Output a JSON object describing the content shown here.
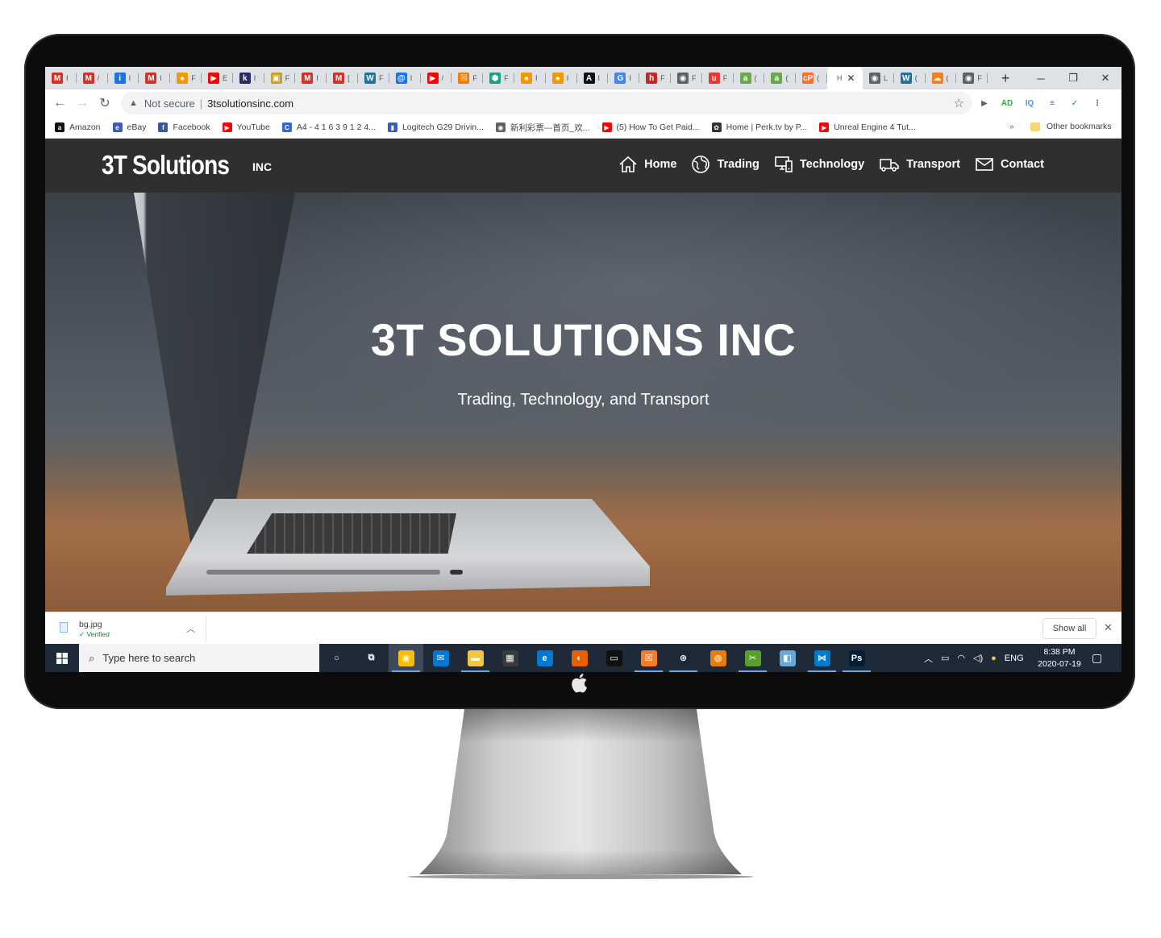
{
  "browser": {
    "tabs": [
      {
        "icon": "gmail-icon",
        "letter": "M",
        "color": "#d93025",
        "title": "I"
      },
      {
        "icon": "gmail-icon",
        "letter": "M",
        "color": "#d93025",
        "title": "/"
      },
      {
        "icon": "info-icon",
        "letter": "i",
        "color": "#1a73e8",
        "title": "I"
      },
      {
        "icon": "gmail-icon",
        "letter": "M",
        "color": "#d93025",
        "title": "I"
      },
      {
        "icon": "orange-leaf-icon",
        "letter": "♠",
        "color": "#f29900",
        "title": "F"
      },
      {
        "icon": "youtube-icon",
        "letter": "▶",
        "color": "#ff0000",
        "title": "E"
      },
      {
        "icon": "k-icon",
        "letter": "k",
        "color": "#2a2a6a",
        "title": "I"
      },
      {
        "icon": "gold-icon",
        "letter": "▣",
        "color": "#c9a227",
        "title": "F"
      },
      {
        "icon": "gmail-icon",
        "letter": "M",
        "color": "#d93025",
        "title": "I"
      },
      {
        "icon": "gmail-icon",
        "letter": "M",
        "color": "#d93025",
        "title": "["
      },
      {
        "icon": "wordpress-icon",
        "letter": "W",
        "color": "#21759b",
        "title": "F"
      },
      {
        "icon": "spiral-icon",
        "letter": "@",
        "color": "#1a73e8",
        "title": "I"
      },
      {
        "icon": "youtube-icon",
        "letter": "▶",
        "color": "#ff0000",
        "title": "/"
      },
      {
        "icon": "xampp-icon",
        "letter": "☒",
        "color": "#f57c00",
        "title": "F"
      },
      {
        "icon": "shield-icon",
        "letter": "⬢",
        "color": "#11a683",
        "title": "F"
      },
      {
        "icon": "orange-leaf-icon",
        "letter": "♠",
        "color": "#f29900",
        "title": "I"
      },
      {
        "icon": "orange-leaf-icon",
        "letter": "♠",
        "color": "#f29900",
        "title": "I"
      },
      {
        "icon": "a-icon",
        "letter": "A",
        "color": "#111111",
        "title": "I"
      },
      {
        "icon": "google-icon",
        "letter": "G",
        "color": "#4285f4",
        "title": "I"
      },
      {
        "icon": "h-icon",
        "letter": "h",
        "color": "#c62828",
        "title": "F"
      },
      {
        "icon": "globe-icon",
        "letter": "◉",
        "color": "#5f6368",
        "title": "F"
      },
      {
        "icon": "u-icon",
        "letter": "u",
        "color": "#e53935",
        "title": "F"
      },
      {
        "icon": "a-green-icon",
        "letter": "a",
        "color": "#6aa84f",
        "title": "("
      },
      {
        "icon": "a-green-icon",
        "letter": "a",
        "color": "#6aa84f",
        "title": "("
      },
      {
        "icon": "cp-icon",
        "letter": "cP",
        "color": "#ff6c2c",
        "title": "("
      },
      {
        "icon": "active-tab",
        "letter": "",
        "color": "#ffffff",
        "title": "H"
      },
      {
        "icon": "globe-icon",
        "letter": "◉",
        "color": "#5f6368",
        "title": "L"
      },
      {
        "icon": "wordpress-icon",
        "letter": "W",
        "color": "#21759b",
        "title": "("
      },
      {
        "icon": "cloud-icon",
        "letter": "☁",
        "color": "#f38020",
        "title": "("
      },
      {
        "icon": "globe-icon",
        "letter": "◉",
        "color": "#5f6368",
        "title": "F"
      }
    ],
    "security_label": "Not secure",
    "url": "3tsolutionsinc.com",
    "extensions": [
      {
        "icon": "video-ext-icon",
        "letter": "▶",
        "color": "#5f6368"
      },
      {
        "icon": "adblock-ext-icon",
        "letter": "AD",
        "color": "#34a853"
      },
      {
        "icon": "iq-ext-icon",
        "letter": "IQ",
        "color": "#4a90e2"
      },
      {
        "icon": "playlist-ext-icon",
        "letter": "≡",
        "color": "#5f6368"
      },
      {
        "icon": "shield-ext-icon",
        "letter": "✓",
        "color": "#1e8e3e"
      },
      {
        "icon": "menu-dots-icon",
        "letter": "⋮",
        "color": "#5f6368"
      }
    ],
    "bookmarks": [
      {
        "icon": "amazon-icon",
        "letter": "a",
        "color": "#111111",
        "label": "Amazon"
      },
      {
        "icon": "ebay-icon",
        "letter": "e",
        "color": "#3b5bbd",
        "label": "eBay"
      },
      {
        "icon": "facebook-icon",
        "letter": "f",
        "color": "#3b5998",
        "label": "Facebook"
      },
      {
        "icon": "youtube-icon",
        "letter": "▶",
        "color": "#ff0000",
        "label": "YouTube"
      },
      {
        "icon": "c-circle-icon",
        "letter": "C",
        "color": "#3367d6",
        "label": "A4 - 4 1 6 3 9 1 2 4..."
      },
      {
        "icon": "bag-icon",
        "letter": "▮",
        "color": "#3b5bbd",
        "label": "Logitech G29 Drivin..."
      },
      {
        "icon": "globe-icon",
        "letter": "◉",
        "color": "#5f6368",
        "label": "新利彩票---首页_欢..."
      },
      {
        "icon": "youtube-icon",
        "letter": "▶",
        "color": "#ff0000",
        "label": "(5) How To Get Paid..."
      },
      {
        "icon": "perk-icon",
        "letter": "✿",
        "color": "#333333",
        "label": "Home | Perk.tv by P..."
      },
      {
        "icon": "youtube-icon",
        "letter": "▶",
        "color": "#ff0000",
        "label": "Unreal Engine 4 Tut..."
      }
    ],
    "bookmarks_more": "»",
    "other_bookmarks": "Other bookmarks"
  },
  "site": {
    "logo": "3T Solutions",
    "logo_suffix": "INC",
    "nav": [
      {
        "icon": "home-icon",
        "label": "Home"
      },
      {
        "icon": "globe-icon",
        "label": "Trading"
      },
      {
        "icon": "computer-icon",
        "label": "Technology"
      },
      {
        "icon": "truck-icon",
        "label": "Transport"
      },
      {
        "icon": "envelope-icon",
        "label": "Contact"
      }
    ],
    "hero_title": "3T SOLUTIONS INC",
    "hero_subtitle": "Trading, Technology, and Transport"
  },
  "download": {
    "file_name": "bg.jpg",
    "status": "Verified",
    "show_all": "Show all"
  },
  "taskbar": {
    "search_placeholder": "Type here to search",
    "apps": [
      {
        "icon": "cortana-icon",
        "glyph": "○",
        "color": "transparent",
        "state": ""
      },
      {
        "icon": "task-view-icon",
        "glyph": "⧉",
        "color": "transparent",
        "state": ""
      },
      {
        "icon": "chrome-icon",
        "glyph": "◉",
        "color": "#fbbc04",
        "state": "act"
      },
      {
        "icon": "mail-icon",
        "glyph": "✉",
        "color": "#0078d4",
        "state": ""
      },
      {
        "icon": "file-explorer-icon",
        "glyph": "▬",
        "color": "#f4c542",
        "state": "run"
      },
      {
        "icon": "store-icon",
        "glyph": "▦",
        "color": "#3a3a3a",
        "state": ""
      },
      {
        "icon": "edge-icon",
        "glyph": "e",
        "color": "#0078d4",
        "state": ""
      },
      {
        "icon": "firefox-icon",
        "glyph": "◐",
        "color": "#e66000",
        "state": ""
      },
      {
        "icon": "terminal-icon",
        "glyph": "▭",
        "color": "#111111",
        "state": ""
      },
      {
        "icon": "xampp-icon",
        "glyph": "☒",
        "color": "#fb7a24",
        "state": "run"
      },
      {
        "icon": "steam-icon",
        "glyph": "⊛",
        "color": "#1b2838",
        "state": "run"
      },
      {
        "icon": "blender-icon",
        "glyph": "◍",
        "color": "#e87d0d",
        "state": ""
      },
      {
        "icon": "tool-icon",
        "glyph": "✂",
        "color": "#5aa02c",
        "state": "run"
      },
      {
        "icon": "app-icon",
        "glyph": "◧",
        "color": "#6aa8d8",
        "state": ""
      },
      {
        "icon": "vscode-icon",
        "glyph": "⋈",
        "color": "#007acc",
        "state": "run"
      },
      {
        "icon": "photoshop-icon",
        "glyph": "Ps",
        "color": "#001e36",
        "state": "run"
      }
    ],
    "language": "ENG",
    "time": "8:38 PM",
    "date": "2020-07-19"
  }
}
